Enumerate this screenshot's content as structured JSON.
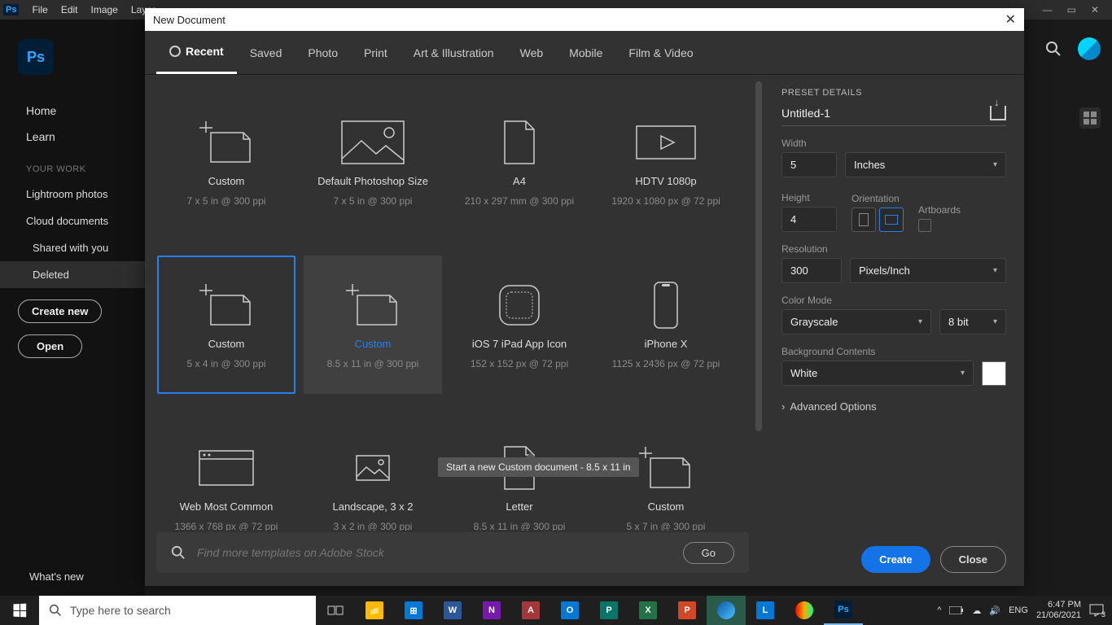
{
  "app": {
    "badge": "Ps"
  },
  "menu": [
    "File",
    "Edit",
    "Image",
    "Layer"
  ],
  "sidebar": {
    "home": "Home",
    "learn": "Learn",
    "section": "YOUR WORK",
    "items": [
      "Lightroom photos",
      "Cloud documents",
      "Shared with you",
      "Deleted"
    ],
    "createNew": "Create new",
    "open": "Open",
    "whatsnew": "What's new"
  },
  "dialog": {
    "title": "New Document",
    "tabs": [
      "Recent",
      "Saved",
      "Photo",
      "Print",
      "Art & Illustration",
      "Web",
      "Mobile",
      "Film & Video"
    ],
    "presets": [
      {
        "title": "Custom",
        "sub": "7 x 5 in @ 300 ppi",
        "icon": "page-fold"
      },
      {
        "title": "Default Photoshop Size",
        "sub": "7 x 5 in @ 300 ppi",
        "icon": "image"
      },
      {
        "title": "A4",
        "sub": "210 x 297 mm @ 300 ppi",
        "icon": "page"
      },
      {
        "title": "HDTV 1080p",
        "sub": "1920 x 1080 px @ 72 ppi",
        "icon": "video"
      },
      {
        "title": "Custom",
        "sub": "5 x 4 in @ 300 ppi",
        "icon": "page-fold"
      },
      {
        "title": "Custom",
        "sub": "8.5 x 11 in @ 300 ppi",
        "icon": "page-fold"
      },
      {
        "title": "iOS 7 iPad App Icon",
        "sub": "152 x 152 px @ 72 ppi",
        "icon": "appicon"
      },
      {
        "title": "iPhone X",
        "sub": "1125 x 2436 px @ 72 ppi",
        "icon": "phone"
      },
      {
        "title": "Web Most Common",
        "sub": "1366 x 768 px @ 72 ppi",
        "icon": "browser"
      },
      {
        "title": "Landscape, 3 x 2",
        "sub": "3 x 2 in @ 300 ppi",
        "icon": "image-small"
      },
      {
        "title": "Letter",
        "sub": "8.5 x 11 in @ 300 ppi",
        "icon": "page"
      },
      {
        "title": "Custom",
        "sub": "5 x 7 in @ 300 ppi",
        "icon": "page-fold"
      }
    ],
    "tooltip": "Start a new Custom document - 8.5 x 11 in",
    "searchPlaceholder": "Find more templates on Adobe Stock",
    "go": "Go",
    "details": {
      "header": "PRESET DETAILS",
      "name": "Untitled-1",
      "widthLabel": "Width",
      "width": "5",
      "units": "Inches",
      "heightLabel": "Height",
      "height": "4",
      "orientationLabel": "Orientation",
      "artboardsLabel": "Artboards",
      "resolutionLabel": "Resolution",
      "resolution": "300",
      "resUnits": "Pixels/Inch",
      "colorModeLabel": "Color Mode",
      "colorMode": "Grayscale",
      "bits": "8 bit",
      "bgLabel": "Background Contents",
      "bg": "White",
      "advanced": "Advanced Options"
    },
    "create": "Create",
    "close": "Close"
  },
  "taskbar": {
    "searchPlaceholder": "Type here to search",
    "lang": "ENG",
    "time": "6:47 PM",
    "date": "21/06/2021",
    "notif": "3"
  }
}
